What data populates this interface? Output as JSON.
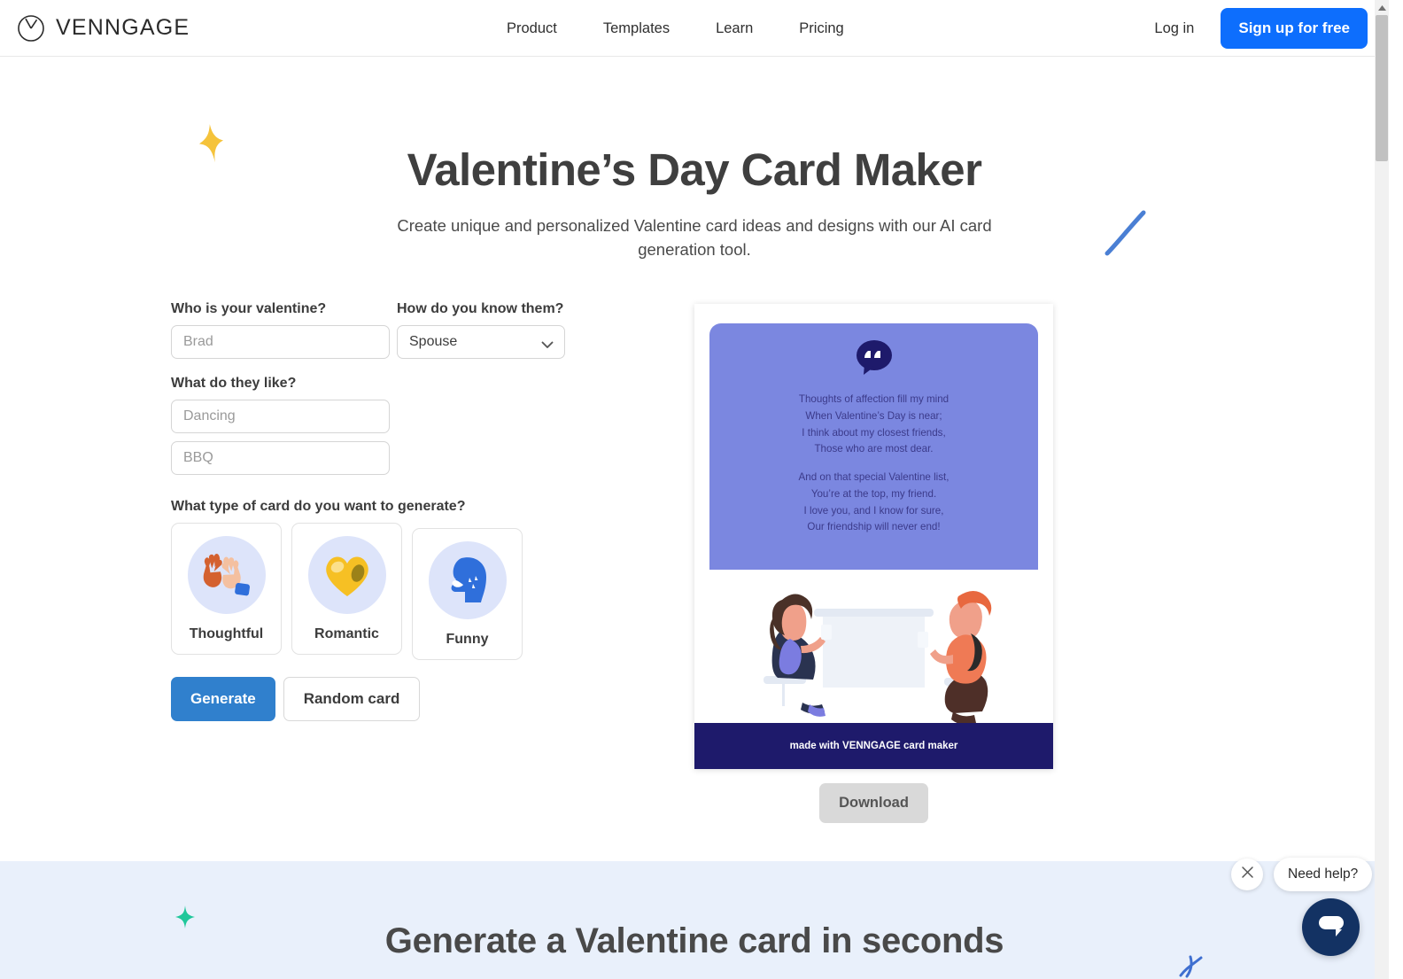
{
  "header": {
    "brand_name": "VENNGAGE",
    "brand_icon": "venngage-circle-logo",
    "nav": [
      {
        "label": "Product"
      },
      {
        "label": "Templates"
      },
      {
        "label": "Learn"
      },
      {
        "label": "Pricing"
      }
    ],
    "login_label": "Log in",
    "signup_label": "Sign up for free"
  },
  "hero": {
    "title": "Valentine’s Day Card Maker",
    "subtitle": "Create unique and personalized Valentine card ideas and designs with our AI card generation tool.",
    "decor_sparkle": "sparkle-yellow",
    "decor_swoosh": "swoosh-blue"
  },
  "form": {
    "valentine_label": "Who is your valentine?",
    "valentine_placeholder": "Brad",
    "valentine_value": "",
    "relationship_label": "How do you know them?",
    "relationship_selected": "Spouse",
    "likes_label": "What do they like?",
    "like1_placeholder": "Dancing",
    "like1_value": "",
    "like2_placeholder": "BBQ",
    "like2_value": "",
    "card_type_label": "What type of card do you want to generate?",
    "card_types": [
      {
        "label": "Thoughtful",
        "icon": "clapping-hands-icon"
      },
      {
        "label": "Romantic",
        "icon": "yellow-heart-icon"
      },
      {
        "label": "Funny",
        "icon": "speaking-head-icon"
      }
    ],
    "generate_label": "Generate",
    "random_label": "Random card"
  },
  "preview": {
    "quote_icon": "quote-speech-bubble-icon",
    "poem_line_1": "Thoughts of affection fill my mind",
    "poem_line_2": "When Valentine’s Day is near;",
    "poem_line_3": "I think about my closest friends,",
    "poem_line_4": "Those who are most dear.",
    "poem_line_5": "And on that special Valentine list,",
    "poem_line_6": "You’re at the top, my friend.",
    "poem_line_7": "I love you, and I know for sure,",
    "poem_line_8": "Our friendship will never end!",
    "illustration": "two-people-at-table-illustration",
    "footer_text": "made with VENNGAGE card maker",
    "download_label": "Download"
  },
  "band": {
    "title": "Generate a Valentine card in seconds",
    "decor_sparkle": "sparkle-green"
  },
  "chat": {
    "close_icon": "close-icon",
    "tooltip": "Need help?",
    "fab_icon": "chat-bubble-icon"
  },
  "colors": {
    "accent_blue": "#0d6efd",
    "generate_blue": "#3080cd",
    "card_purple": "#7b87e0",
    "card_footer_navy": "#1e1a6b",
    "band_bg": "#e9f0fb",
    "chat_navy": "#133263",
    "sparkle_yellow": "#f5c33b",
    "sparkle_green": "#1fc79a"
  }
}
